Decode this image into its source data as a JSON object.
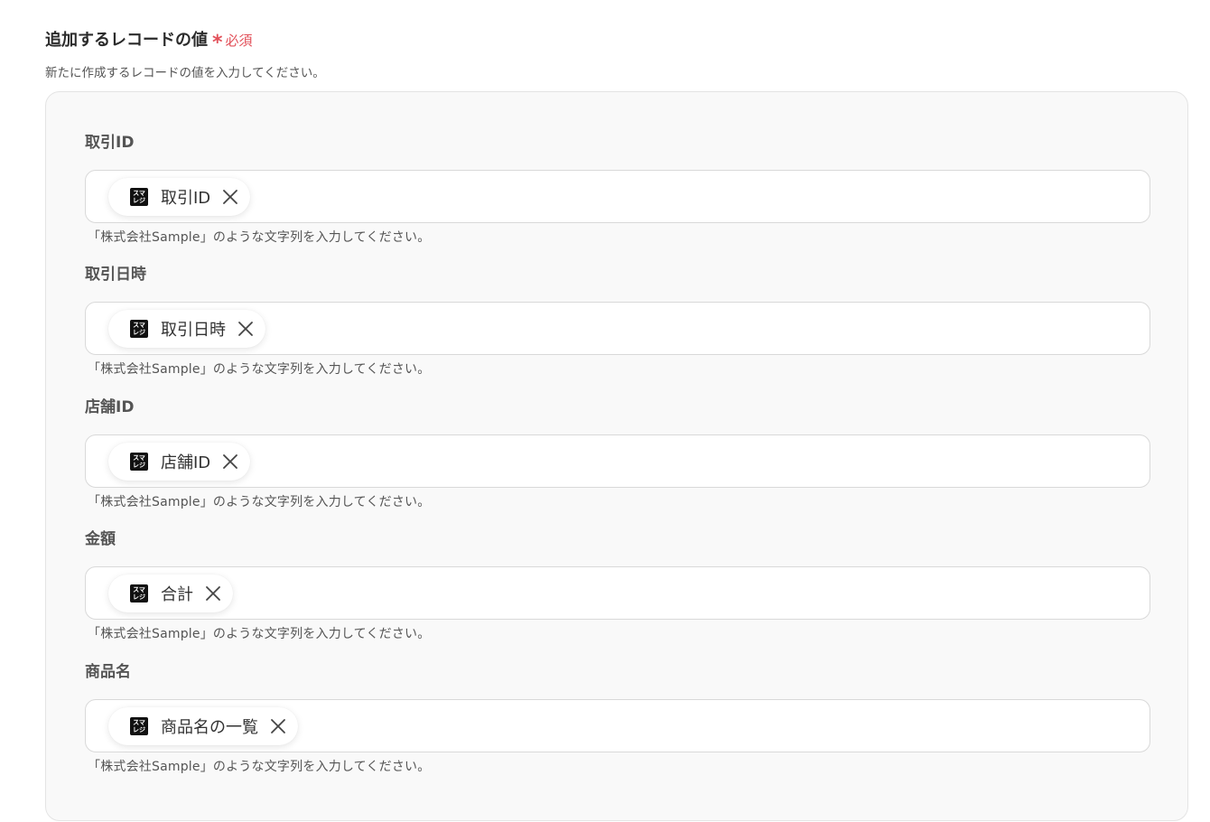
{
  "section": {
    "title": "追加するレコードの値",
    "required_star": "*",
    "required_label": "必須",
    "description": "新たに作成するレコードの値を入力してください。"
  },
  "app_icon": {
    "name": "smaregi-app-icon",
    "text": "スマレジ"
  },
  "colors": {
    "required": "#e2515a",
    "panel_bg": "#f9f9f9",
    "border": "#d9d9d9"
  },
  "fields": [
    {
      "label": "取引ID",
      "chip": "取引ID",
      "hint": "「株式会社Sample」のような文字列を入力してください。"
    },
    {
      "label": "取引日時",
      "chip": "取引日時",
      "hint": "「株式会社Sample」のような文字列を入力してください。"
    },
    {
      "label": "店舗ID",
      "chip": "店舗ID",
      "hint": "「株式会社Sample」のような文字列を入力してください。"
    },
    {
      "label": "金額",
      "chip": "合計",
      "hint": "「株式会社Sample」のような文字列を入力してください。"
    },
    {
      "label": "商品名",
      "chip": "商品名の一覧",
      "hint": "「株式会社Sample」のような文字列を入力してください。"
    }
  ]
}
